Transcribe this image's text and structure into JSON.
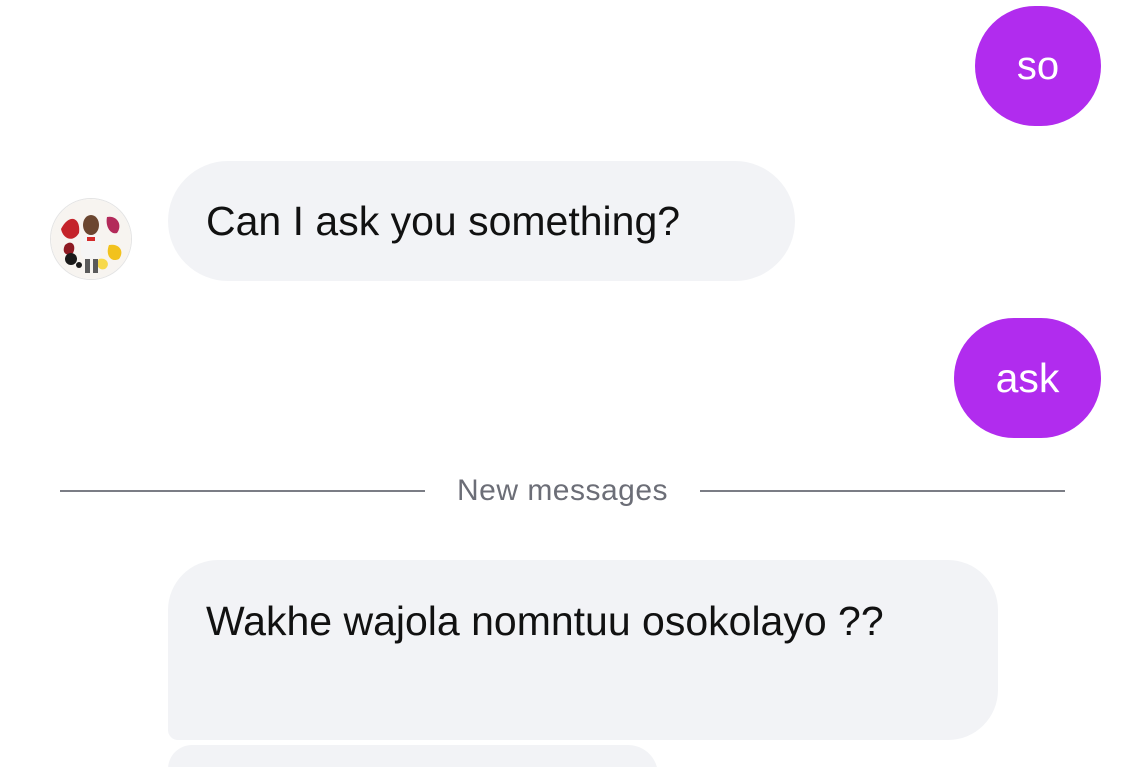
{
  "conversation": {
    "messages": [
      {
        "direction": "sent",
        "text": "so"
      },
      {
        "direction": "received",
        "text": "Can I ask you something?"
      },
      {
        "direction": "sent",
        "text": "ask"
      },
      {
        "direction": "received",
        "text": "Wakhe wajola nomntuu osokolayo ??"
      }
    ],
    "divider": {
      "label": "New messages"
    }
  },
  "contact": {
    "avatar_icon": "profile-photo"
  },
  "colors": {
    "sent_bubble": "#b12cee",
    "received_bubble": "#f2f3f6",
    "divider_line": "#7b7d85"
  }
}
